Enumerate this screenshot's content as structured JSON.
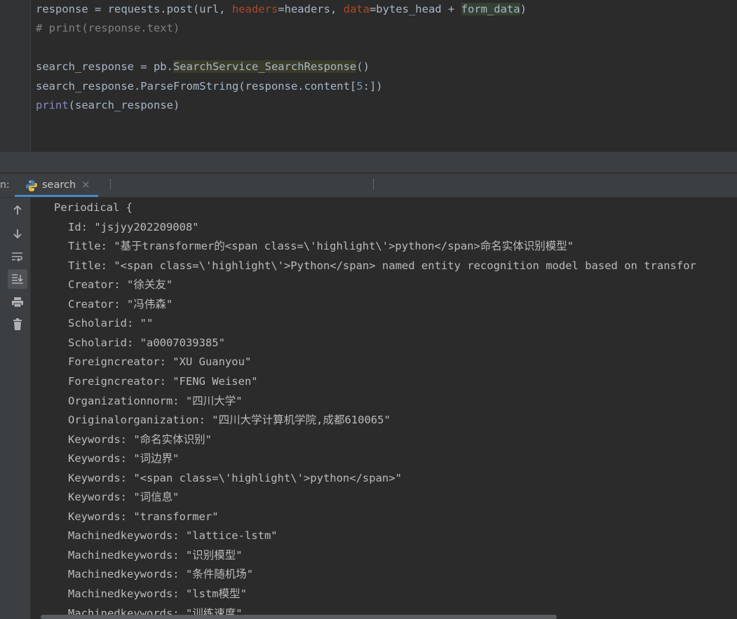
{
  "editor": {
    "lines": [
      {
        "segments": [
          {
            "text": "response = requests.post(url, ",
            "cls": ""
          },
          {
            "text": "headers",
            "cls": "kw-param"
          },
          {
            "text": "=headers, ",
            "cls": ""
          },
          {
            "text": "data",
            "cls": "kw-param"
          },
          {
            "text": "=bytes_head + ",
            "cls": ""
          },
          {
            "text": "form_data",
            "cls": "hl-a"
          },
          {
            "text": ")",
            "cls": ""
          }
        ]
      },
      {
        "segments": [
          {
            "text": "# print(response.text)",
            "cls": "cm"
          }
        ]
      },
      {
        "segments": []
      },
      {
        "segments": [
          {
            "text": "search_response = pb.",
            "cls": ""
          },
          {
            "text": "SearchService_SearchResponse",
            "cls": "hl-b"
          },
          {
            "text": "()",
            "cls": ""
          }
        ]
      },
      {
        "segments": [
          {
            "text": "search_response.ParseFromString(response.content[",
            "cls": ""
          },
          {
            "text": "5",
            "cls": "num"
          },
          {
            "text": ":])",
            "cls": ""
          }
        ]
      },
      {
        "segments": [
          {
            "text": "print",
            "cls": "bi"
          },
          {
            "text": "(search_response)",
            "cls": ""
          }
        ]
      }
    ]
  },
  "run_panel": {
    "label": "n:",
    "tab": {
      "title": "search",
      "close": "×"
    }
  },
  "toolbar": [
    {
      "name": "scroll-up-icon",
      "active": false
    },
    {
      "name": "scroll-down-icon",
      "active": false
    },
    {
      "name": "soft-wrap-icon",
      "active": false
    },
    {
      "name": "scroll-to-end-icon",
      "active": true
    },
    {
      "name": "print-icon",
      "active": false
    },
    {
      "name": "clear-all-icon",
      "active": false
    }
  ],
  "console": {
    "lines": [
      {
        "indent": 0,
        "text": "Periodical {"
      },
      {
        "indent": 1,
        "text": "Id: \"jsjyy202209008\""
      },
      {
        "indent": 1,
        "text": "Title: \"基于transformer的<span class=\\'highlight\\'>python</span>命名实体识别模型\""
      },
      {
        "indent": 1,
        "text": "Title: \"<span class=\\'highlight\\'>Python</span> named entity recognition model based on transfor"
      },
      {
        "indent": 1,
        "text": "Creator: \"徐关友\""
      },
      {
        "indent": 1,
        "text": "Creator: \"冯伟森\""
      },
      {
        "indent": 1,
        "text": "Scholarid: \"\""
      },
      {
        "indent": 1,
        "text": "Scholarid: \"a0007039385\""
      },
      {
        "indent": 1,
        "text": "Foreigncreator: \"XU Guanyou\""
      },
      {
        "indent": 1,
        "text": "Foreigncreator: \"FENG Weisen\""
      },
      {
        "indent": 1,
        "text": "Organizationnorm: \"四川大学\""
      },
      {
        "indent": 1,
        "text": "Originalorganization: \"四川大学计算机学院,成都610065\""
      },
      {
        "indent": 1,
        "text": "Keywords: \"命名实体识别\""
      },
      {
        "indent": 1,
        "text": "Keywords: \"词边界\""
      },
      {
        "indent": 1,
        "text": "Keywords: \"<span class=\\'highlight\\'>python</span>\""
      },
      {
        "indent": 1,
        "text": "Keywords: \"词信息\""
      },
      {
        "indent": 1,
        "text": "Keywords: \"transformer\""
      },
      {
        "indent": 1,
        "text": "Machinedkeywords: \"lattice-lstm\""
      },
      {
        "indent": 1,
        "text": "Machinedkeywords: \"识别模型\""
      },
      {
        "indent": 1,
        "text": "Machinedkeywords: \"条件随机场\""
      },
      {
        "indent": 1,
        "text": "Machinedkeywords: \"lstm模型\""
      },
      {
        "indent": 1,
        "text": "Machinedkeywords: \"训练速度\""
      }
    ]
  }
}
